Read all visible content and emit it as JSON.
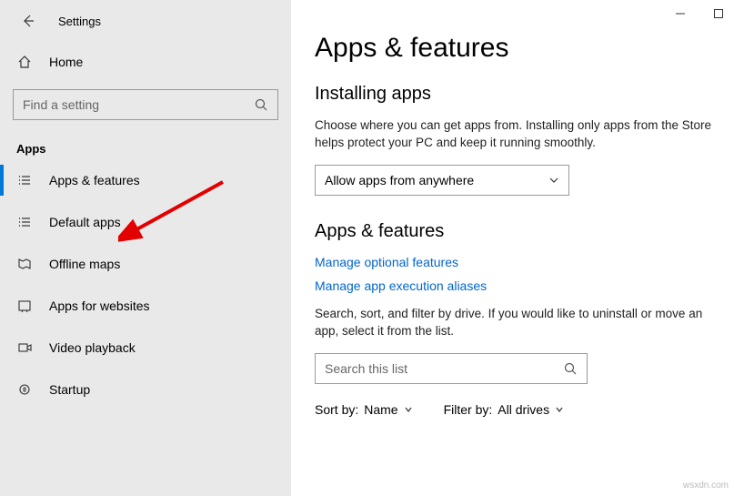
{
  "window": {
    "title": "Settings"
  },
  "home_label": "Home",
  "search_placeholder": "Find a setting",
  "section_label": "Apps",
  "nav": [
    {
      "id": "apps-features",
      "label": "Apps & features"
    },
    {
      "id": "default-apps",
      "label": "Default apps"
    },
    {
      "id": "offline-maps",
      "label": "Offline maps"
    },
    {
      "id": "apps-for-websites",
      "label": "Apps for websites"
    },
    {
      "id": "video-playback",
      "label": "Video playback"
    },
    {
      "id": "startup",
      "label": "Startup"
    }
  ],
  "main": {
    "heading": "Apps & features",
    "installing": {
      "title": "Installing apps",
      "desc": "Choose where you can get apps from. Installing only apps from the Store helps protect your PC and keep it running smoothly.",
      "dropdown_value": "Allow apps from anywhere"
    },
    "apps": {
      "title": "Apps & features",
      "link1": "Manage optional features",
      "link2": "Manage app execution aliases",
      "desc": "Search, sort, and filter by drive. If you would like to uninstall or move an app, select it from the list.",
      "search_placeholder": "Search this list",
      "sort_label": "Sort by:",
      "sort_value": "Name",
      "filter_label": "Filter by:",
      "filter_value": "All drives"
    }
  },
  "watermark": "wsxdn.com"
}
